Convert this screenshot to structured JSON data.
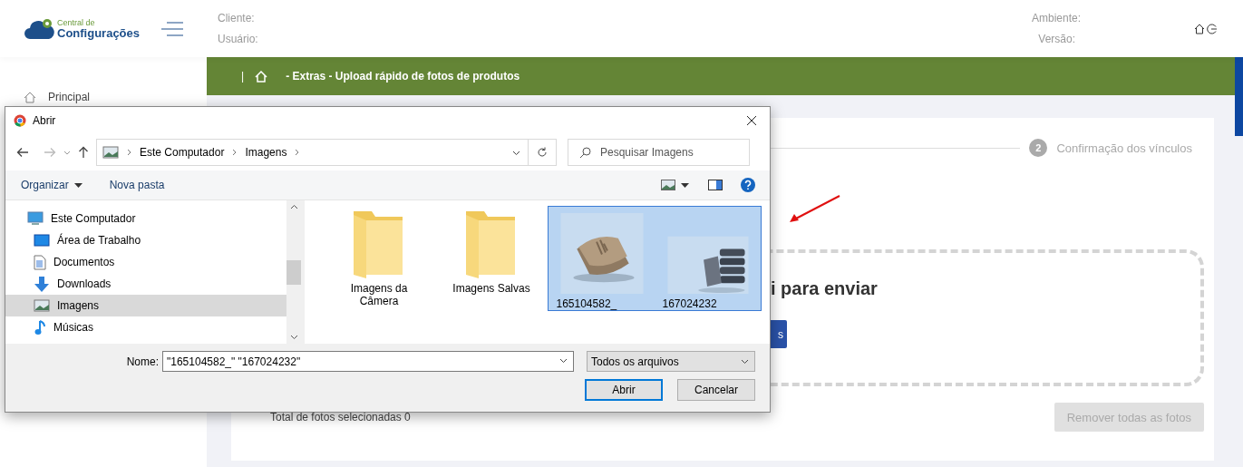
{
  "header": {
    "logo": {
      "line1": "Central de",
      "line2": "Configurações"
    },
    "client_label": "Cliente:",
    "user_label": "Usuário:",
    "environment_label": "Ambiente:",
    "version_label": "Versão:"
  },
  "sidebar": {
    "items": [
      {
        "label": "Principal"
      }
    ]
  },
  "breadcrumb": {
    "separator": "|",
    "text": "- Extras - Upload rápido de fotos de produtos"
  },
  "stepper": {
    "steps": [
      {
        "number": "2",
        "label": "Confirmação dos vínculos"
      }
    ]
  },
  "dropzone": {
    "text": "i para enviar",
    "button": "s"
  },
  "total_label": "Total de fotos selecionadas 0",
  "remove_button": {
    "label": "Remover todas as fotos",
    "disabled": true
  },
  "dialog": {
    "title": "Abrir",
    "path": [
      "Este Computador",
      "Imagens"
    ],
    "search": {
      "placeholder": "Pesquisar Imagens"
    },
    "toolbar": [
      "Organizar",
      "Nova pasta"
    ],
    "tree": [
      {
        "label": "Este Computador",
        "kind": "computer",
        "selected": false,
        "children": [
          {
            "label": "Área de Trabalho",
            "kind": "desktop",
            "selected": false
          },
          {
            "label": "Documentos",
            "kind": "document",
            "selected": false
          },
          {
            "label": "Downloads",
            "kind": "download",
            "selected": false
          },
          {
            "label": "Imagens",
            "kind": "pictures",
            "selected": true
          },
          {
            "label": "Músicas",
            "kind": "music",
            "selected": false
          }
        ]
      }
    ],
    "files": [
      {
        "name": "Imagens da Câmera",
        "kind": "folder",
        "selected": false
      },
      {
        "name": "Imagens Salvas",
        "kind": "folder",
        "selected": false
      },
      {
        "name": "165104582_",
        "selected": true
      },
      {
        "name": "167024232",
        "selected": true
      }
    ],
    "filename_label": "Nome:",
    "filename": "\"165104582_\" \"167024232\"",
    "filter": "Todos os arquivos",
    "buttons": [
      "Abrir",
      "Cancelar"
    ]
  }
}
